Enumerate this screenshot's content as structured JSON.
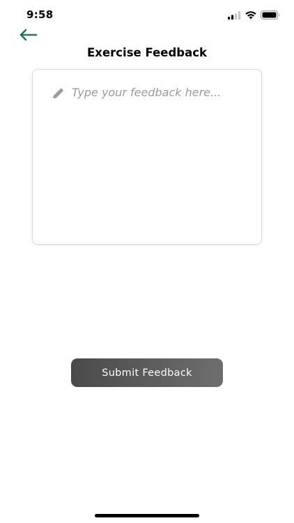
{
  "status_bar": {
    "time": "9:58"
  },
  "header": {
    "title": "Exercise Feedback"
  },
  "feedback": {
    "value": "",
    "placeholder": "Type your feedback here..."
  },
  "submit": {
    "label": "Submit Feedback"
  },
  "colors": {
    "accent": "#1e7a56",
    "button_dark": "#4a4a4a",
    "button_light": "#6e6e6e",
    "placeholder": "#9b9b9b",
    "border": "#d9d9d9"
  },
  "icons": {
    "back": "arrow-left-icon",
    "field": "pencil-icon",
    "signal": "cellular-signal-icon",
    "wifi": "wifi-icon",
    "battery": "battery-icon"
  }
}
